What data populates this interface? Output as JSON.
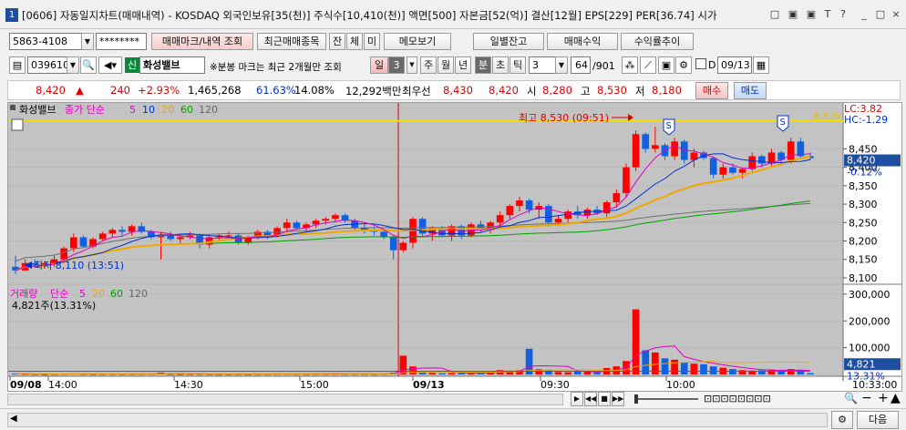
{
  "titlebar": {
    "num": "1",
    "title": "[0606] 자동일지차트(매매내역) - KOSDAQ 외국인보유[35(천)] 주식수[10,410(천)] 액면[500] 자본금[52(억)] 결산[12월] EPS[229] PER[36.74] 시가",
    "buttons": [
      "□",
      "▣",
      "▣",
      "T",
      "?",
      "_",
      "□",
      "×"
    ]
  },
  "toolbar1": {
    "account": "5863-4108",
    "password": "********",
    "buttons": [
      "매매마크/내역 조회",
      "최근매매종목",
      "잔",
      "체",
      "미",
      "메모보기",
      "일별잔고",
      "매매수익",
      "수익률추이"
    ]
  },
  "toolbar2": {
    "code": "039610",
    "badge": "신",
    "name": "화성밸브",
    "note": "※분봉 마크는 최근 2개월만 조회",
    "period_tabs": [
      "일",
      "3",
      "주",
      "월",
      "년",
      "분",
      "초",
      "틱"
    ],
    "interval": "3",
    "count": "64",
    "total": "/901",
    "d_label": "D",
    "date": "09/13"
  },
  "quote": {
    "price": "8,420",
    "arrow": "▲",
    "change": "240",
    "pct": "+2.93%",
    "volume": "1,465,268",
    "vol_ratio": "61.63%",
    "turnover": "14.08%",
    "amount": "12,292백만",
    "best_ask_label": "최우선",
    "best_ask": "8,430",
    "best_bid": "8,420",
    "open_label": "시",
    "open": "8,280",
    "high_label": "고",
    "high": "8,530",
    "low_label": "저",
    "low": "8,180",
    "buy": "매수",
    "sell": "매도"
  },
  "chart_data": {
    "type": "candlestick",
    "price_legend": {
      "name": "화성밸브",
      "ma_label": "종가 단순",
      "ma_periods": [
        "5",
        "10",
        "20",
        "60",
        "120"
      ]
    },
    "price_axis_ticks": [
      "8,450",
      "8,400",
      "8,350",
      "8,300",
      "8,250",
      "8,200",
      "8,150",
      "8,100"
    ],
    "lc_label": "LC:3.82",
    "hc_label": "HC:-1.29",
    "current_price_label": "8,420",
    "current_pct_label": "-0.12%",
    "yellow_line_label": "8,526",
    "high_annotation": "최고 8,530 (09:51)",
    "low_annotation": "최저 8,110 (13:51)",
    "sell_marks": [
      "S",
      "S"
    ],
    "volume_legend": {
      "name": "거래량",
      "ma_label": "단순",
      "ma_periods": [
        "5",
        "20",
        "60",
        "120"
      ]
    },
    "volume_value": "4,821주(13.31%)",
    "volume_axis_ticks": [
      "300,000",
      "200,000",
      "100,000"
    ],
    "volume_current_label": "4,821",
    "volume_pct_label": "13.31%",
    "time_labels": [
      "09/08",
      "14:00",
      "14:30",
      "15:00",
      "09/13",
      "09:30",
      "10:00",
      "10:33:00"
    ],
    "ylim": [
      8090,
      8540
    ],
    "candles": [
      [
        8130,
        8110,
        8160,
        8120
      ],
      [
        8120,
        8120,
        8150,
        8140
      ],
      [
        8140,
        8130,
        8150,
        8135
      ],
      [
        8135,
        8125,
        8145,
        8140
      ],
      [
        8140,
        8130,
        8160,
        8150
      ],
      [
        8150,
        8140,
        8185,
        8180
      ],
      [
        8180,
        8170,
        8220,
        8210
      ],
      [
        8210,
        8180,
        8215,
        8185
      ],
      [
        8185,
        8180,
        8210,
        8205
      ],
      [
        8205,
        8200,
        8225,
        8220
      ],
      [
        8220,
        8210,
        8235,
        8230
      ],
      [
        8230,
        8215,
        8240,
        8225
      ],
      [
        8225,
        8215,
        8245,
        8240
      ],
      [
        8240,
        8220,
        8250,
        8225
      ],
      [
        8225,
        8205,
        8230,
        8210
      ],
      [
        8210,
        8150,
        8225,
        8215
      ],
      [
        8215,
        8200,
        8225,
        8205
      ],
      [
        8205,
        8190,
        8215,
        8210
      ],
      [
        8210,
        8205,
        8225,
        8215
      ],
      [
        8215,
        8180,
        8220,
        8190
      ],
      [
        8190,
        8180,
        8215,
        8210
      ],
      [
        8210,
        8200,
        8220,
        8215
      ],
      [
        8215,
        8205,
        8225,
        8215
      ],
      [
        8215,
        8190,
        8220,
        8195
      ],
      [
        8195,
        8190,
        8215,
        8210
      ],
      [
        8210,
        8205,
        8230,
        8225
      ],
      [
        8225,
        8205,
        8230,
        8215
      ],
      [
        8215,
        8210,
        8240,
        8235
      ],
      [
        8235,
        8225,
        8260,
        8250
      ],
      [
        8250,
        8230,
        8255,
        8235
      ],
      [
        8235,
        8225,
        8250,
        8245
      ],
      [
        8245,
        8235,
        8260,
        8255
      ],
      [
        8255,
        8245,
        8265,
        8260
      ],
      [
        8260,
        8250,
        8275,
        8270
      ],
      [
        8270,
        8250,
        8275,
        8255
      ],
      [
        8255,
        8230,
        8260,
        8235
      ],
      [
        8235,
        8220,
        8245,
        8230
      ],
      [
        8230,
        8215,
        8240,
        8225
      ],
      [
        8225,
        8205,
        8230,
        8210
      ],
      [
        8210,
        8150,
        8215,
        8175
      ],
      [
        8175,
        8170,
        8200,
        8195
      ],
      [
        8195,
        8180,
        8265,
        8260
      ],
      [
        8260,
        8210,
        8265,
        8220
      ],
      [
        8220,
        8200,
        8240,
        8235
      ],
      [
        8235,
        8210,
        8240,
        8215
      ],
      [
        8215,
        8200,
        8245,
        8240
      ],
      [
        8240,
        8205,
        8245,
        8215
      ],
      [
        8215,
        8210,
        8250,
        8245
      ],
      [
        8245,
        8225,
        8255,
        8230
      ],
      [
        8230,
        8220,
        8255,
        8250
      ],
      [
        8250,
        8240,
        8280,
        8270
      ],
      [
        8270,
        8260,
        8300,
        8295
      ],
      [
        8295,
        8280,
        8320,
        8310
      ],
      [
        8310,
        8275,
        8315,
        8285
      ],
      [
        8285,
        8260,
        8305,
        8295
      ],
      [
        8295,
        8240,
        8300,
        8250
      ],
      [
        8250,
        8240,
        8270,
        8260
      ],
      [
        8260,
        8250,
        8285,
        8280
      ],
      [
        8280,
        8260,
        8295,
        8270
      ],
      [
        8270,
        8260,
        8290,
        8285
      ],
      [
        8285,
        8270,
        8295,
        8275
      ],
      [
        8275,
        8265,
        8310,
        8305
      ],
      [
        8305,
        8290,
        8340,
        8330
      ],
      [
        8330,
        8320,
        8410,
        8400
      ],
      [
        8400,
        8390,
        8500,
        8490
      ],
      [
        8490,
        8440,
        8495,
        8450
      ],
      [
        8450,
        8440,
        8510,
        8460
      ],
      [
        8460,
        8420,
        8465,
        8430
      ],
      [
        8430,
        8420,
        8480,
        8470
      ],
      [
        8470,
        8410,
        8475,
        8420
      ],
      [
        8420,
        8400,
        8450,
        8440
      ],
      [
        8440,
        8420,
        8445,
        8425
      ],
      [
        8425,
        8370,
        8430,
        8380
      ],
      [
        8380,
        8370,
        8410,
        8400
      ],
      [
        8400,
        8380,
        8410,
        8385
      ],
      [
        8385,
        8370,
        8400,
        8395
      ],
      [
        8395,
        8390,
        8440,
        8430
      ],
      [
        8430,
        8400,
        8435,
        8410
      ],
      [
        8410,
        8400,
        8450,
        8440
      ],
      [
        8440,
        8410,
        8445,
        8420
      ],
      [
        8420,
        8410,
        8480,
        8470
      ],
      [
        8470,
        8425,
        8480,
        8430
      ],
      [
        8430,
        8420,
        8440,
        8425
      ]
    ],
    "volumes": [
      3000,
      2000,
      1500,
      1000,
      1800,
      2500,
      3200,
      1800,
      1500,
      2000,
      2200,
      1800,
      2100,
      2300,
      2500,
      7000,
      1500,
      1200,
      1800,
      2000,
      1700,
      1600,
      1500,
      1800,
      1600,
      2000,
      1900,
      2400,
      2600,
      2100,
      2000,
      2300,
      2500,
      2700,
      2300,
      2100,
      2000,
      1900,
      2400,
      6500,
      70000,
      30000,
      8000,
      6000,
      4000,
      5000,
      5500,
      4500,
      4000,
      8000,
      16000,
      14000,
      15000,
      96000,
      20000,
      15000,
      9000,
      8000,
      12000,
      10000,
      8000,
      24000,
      30000,
      50000,
      243000,
      90000,
      82000,
      60000,
      55000,
      45000,
      40000,
      38000,
      30000,
      25000,
      20000,
      16000,
      14000,
      15000,
      18000,
      13000,
      20000,
      16000,
      4821
    ]
  },
  "bottom": {
    "done_button": "다음"
  }
}
